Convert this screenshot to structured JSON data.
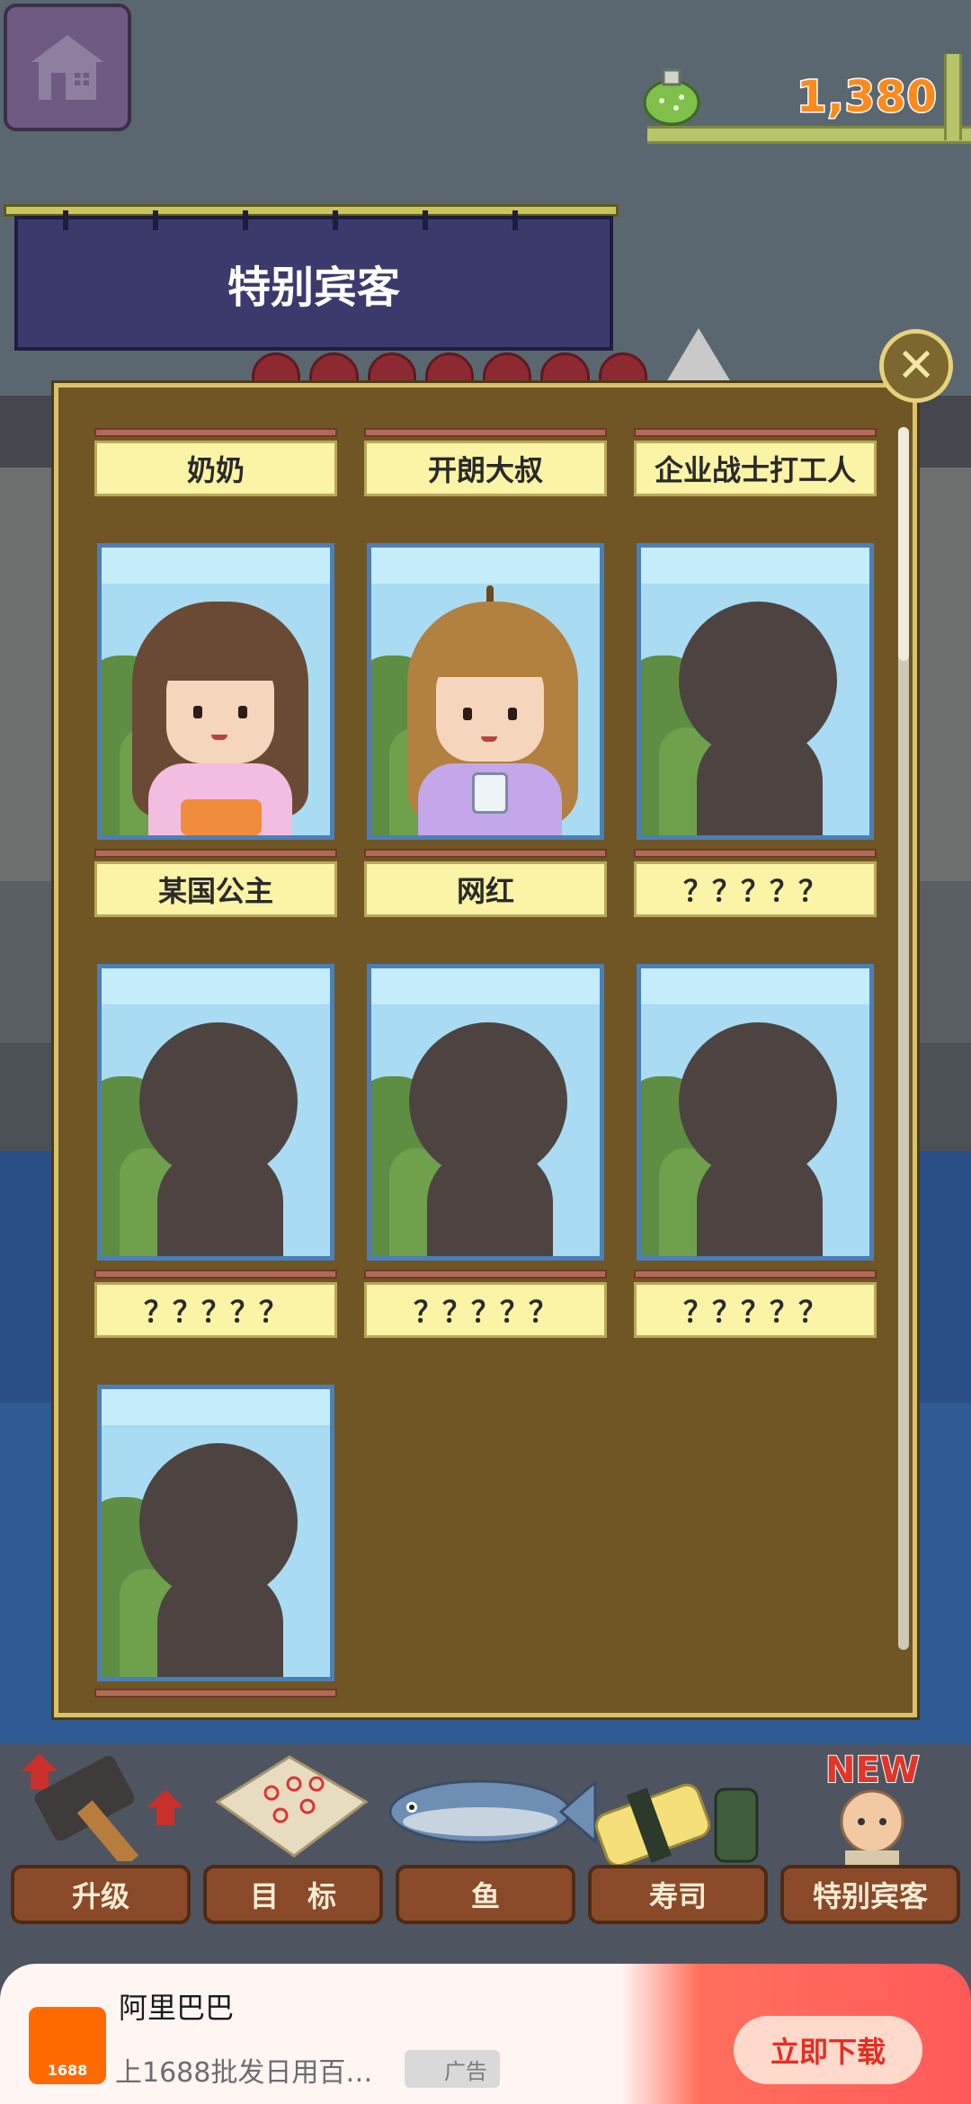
{
  "hud": {
    "coins": "1,380"
  },
  "banner": {
    "title": "特别宾客"
  },
  "guests": {
    "row0_labels": [
      "奶奶",
      "开朗大叔",
      "企业战士打工人"
    ],
    "row1_labels": [
      "某国公主",
      "网红",
      "？？？？？"
    ],
    "row2_labels": [
      "？？？？？",
      "？？？？？",
      "？？？？？"
    ]
  },
  "menu": {
    "upgrade": "升级",
    "goals": "目　标",
    "fish": "鱼",
    "sushi": "寿司",
    "special": "特别宾客",
    "new_badge": "NEW"
  },
  "ad": {
    "title": "阿里巴巴",
    "logo_text": "1688",
    "description": "上1688批发日用百货…",
    "tag": "广告",
    "cta": "立即下载"
  },
  "colors": {
    "banner": "#3c3a6d",
    "panel": "#6f5624",
    "coin": "#ff8a1c",
    "cta": "#e52e22"
  }
}
